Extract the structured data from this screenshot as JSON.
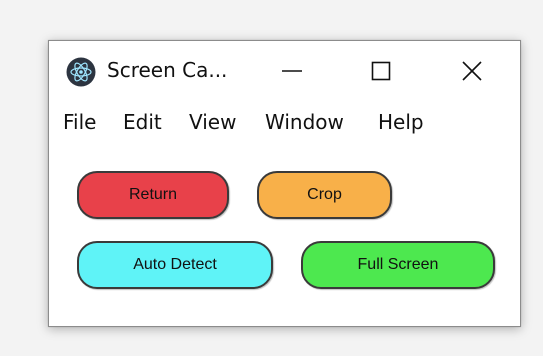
{
  "window": {
    "title": "Screen Ca...",
    "app_icon": "electron-atom-icon",
    "controls": {
      "minimize_icon": "minimize-icon",
      "maximize_icon": "maximize-icon",
      "close_icon": "close-icon"
    }
  },
  "menu": {
    "items": [
      {
        "label": "File"
      },
      {
        "label": "Edit"
      },
      {
        "label": "View"
      },
      {
        "label": "Window"
      },
      {
        "label": "Help"
      }
    ]
  },
  "buttons": {
    "return": {
      "label": "Return",
      "color": "#e8414a"
    },
    "crop": {
      "label": "Crop",
      "color": "#f8b049"
    },
    "auto_detect": {
      "label": "Auto Detect",
      "color": "#5ff3f7"
    },
    "full_screen": {
      "label": "Full Screen",
      "color": "#4de84f"
    }
  }
}
